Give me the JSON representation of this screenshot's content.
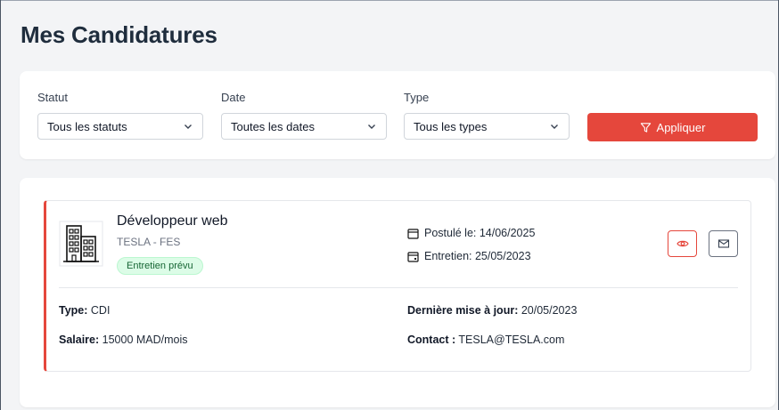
{
  "page": {
    "title": "Mes Candidatures"
  },
  "filters": {
    "status": {
      "label": "Statut",
      "value": "Tous les statuts"
    },
    "date": {
      "label": "Date",
      "value": "Toutes les dates"
    },
    "type": {
      "label": "Type",
      "value": "Tous les types"
    },
    "apply_label": "Appliquer"
  },
  "applications": [
    {
      "title": "Développeur web",
      "company": "TESLA - FES",
      "status_badge": "Entretien prévu",
      "applied_on": "Postulé le: 14/06/2025",
      "interview": "Entretien: 25/05/2023",
      "type_label": "Type:",
      "type_value": "CDI",
      "salary_label": "Salaire:",
      "salary_value": "15000 MAD/mois",
      "updated_label": "Dernière mise à jour:",
      "updated_value": "20/05/2023",
      "contact_label": "Contact :",
      "contact_value": "TESLA@TESLA.com"
    }
  ],
  "icons": {
    "filter": "filter-icon",
    "building": "building-icon",
    "calendar": "calendar-icon",
    "view": "eye-icon",
    "message": "mail-icon",
    "dropdown": "chevron-down-icon"
  },
  "colors": {
    "accent": "#e5473c",
    "badge_bg": "#dcfce7",
    "badge_text": "#166534",
    "title": "#1f2d3d"
  }
}
